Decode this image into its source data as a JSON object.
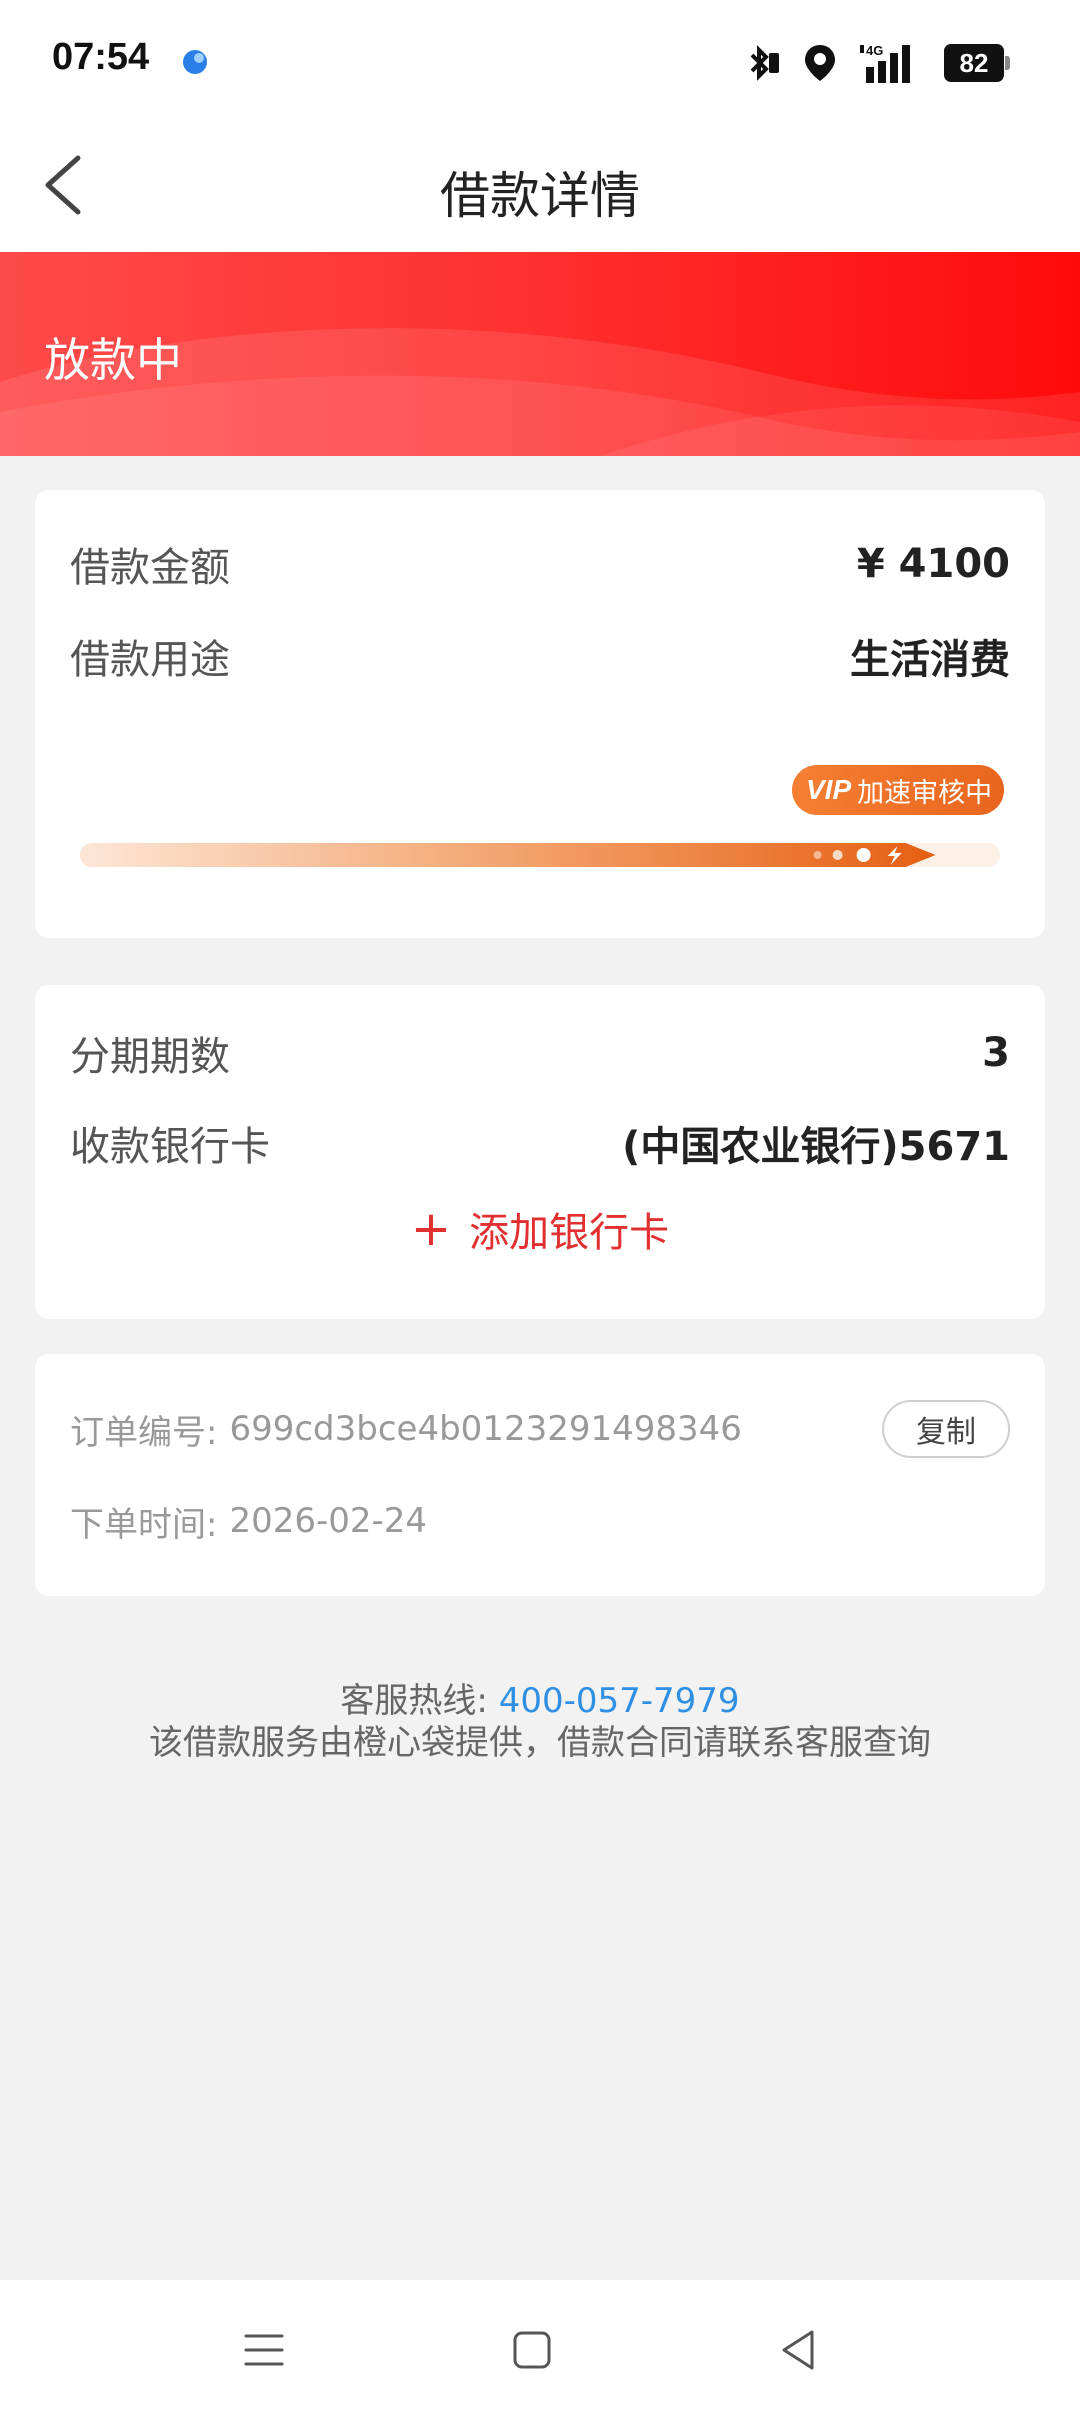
{
  "status_bar": {
    "time": "07:54",
    "battery": "82",
    "network": "4G"
  },
  "nav": {
    "title": "借款详情",
    "back_icon": "chevron-left-icon"
  },
  "banner": {
    "status": "放款中",
    "color": "#ff2f2f"
  },
  "loan_card": {
    "amount_label": "借款金额",
    "amount_value": "¥ 4100",
    "purpose_label": "借款用途",
    "purpose_value": "生活消费",
    "vip_tag": "VIP",
    "vip_text": "加速审核中",
    "progress": 0.93
  },
  "installment_card": {
    "periods_label": "分期期数",
    "periods_value": "3",
    "bank_label": "收款银行卡",
    "bank_value": "(中国农业银行)5671",
    "add_bank_label": "添加银行卡"
  },
  "order_card": {
    "order_no_label": "订单编号:",
    "order_no_value": "699cd3bce4b0123291498346",
    "copy_label": "复制",
    "order_time_label": "下单时间:",
    "order_time_value": "2026-02-24"
  },
  "footer": {
    "hotline_label": "客服热线:",
    "hotline_number": "400-057-7979",
    "notice": "该借款服务由橙心袋提供，借款合同请联系客服查询"
  },
  "colors": {
    "accent_red": "#e23030",
    "progress_orange": "#e9651d",
    "link_blue": "#2e8fe3"
  }
}
